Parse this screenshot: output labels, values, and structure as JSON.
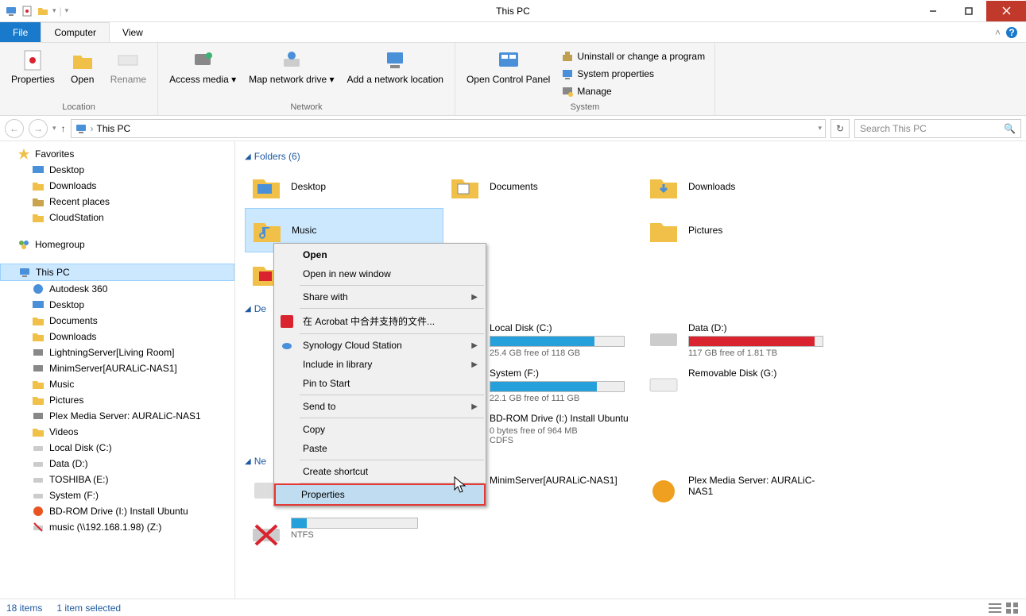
{
  "window": {
    "title": "This PC"
  },
  "tabs": {
    "file": "File",
    "computer": "Computer",
    "view": "View"
  },
  "ribbon": {
    "location": {
      "label": "Location",
      "properties": "Properties",
      "open": "Open",
      "rename": "Rename"
    },
    "network": {
      "label": "Network",
      "access_media": "Access media",
      "map_network": "Map network drive",
      "add_location": "Add a network location"
    },
    "system": {
      "label": "System",
      "open_cp": "Open Control Panel",
      "uninstall": "Uninstall or change a program",
      "sys_props": "System properties",
      "manage": "Manage"
    }
  },
  "breadcrumb": {
    "location": "This PC"
  },
  "search": {
    "placeholder": "Search This PC"
  },
  "sidebar": {
    "favorites": "Favorites",
    "fav_items": [
      "Desktop",
      "Downloads",
      "Recent places",
      "CloudStation"
    ],
    "homegroup": "Homegroup",
    "this_pc": "This PC",
    "pc_items": [
      "Autodesk 360",
      "Desktop",
      "Documents",
      "Downloads",
      "LightningServer[Living Room]",
      "MinimServer[AURALiC-NAS1]",
      "Music",
      "Pictures",
      "Plex Media Server: AURALiC-NAS1",
      "Videos",
      "Local Disk (C:)",
      "Data (D:)",
      "TOSHIBA (E:)",
      "System (F:)",
      "BD-ROM Drive (I:) Install Ubuntu",
      "music (\\\\192.168.1.98) (Z:)"
    ]
  },
  "content": {
    "folders_header": "Folders (6)",
    "devices_header": "De",
    "network_header": "Ne",
    "folders": [
      "Desktop",
      "Documents",
      "Downloads",
      "Music",
      "Pictures",
      "Videos"
    ],
    "drives": [
      {
        "name": "Local Disk (C:)",
        "sub": "25.4 GB free of 118 GB",
        "fill": 78,
        "color": "#26a0da"
      },
      {
        "name": "Data (D:)",
        "sub": "117 GB free of 1.81 TB",
        "fill": 94,
        "color": "#d9232e"
      },
      {
        "name": "System (F:)",
        "sub": "22.1 GB free of 111 GB",
        "fill": 80,
        "color": "#26a0da"
      },
      {
        "name": "Removable Disk (G:)",
        "sub": "",
        "fill": 0,
        "color": ""
      },
      {
        "name": "BD-ROM Drive (I:) Install Ubuntu",
        "sub": "0 bytes free of 964 MB",
        "sub2": "CDFS",
        "fill": 0,
        "color": ""
      }
    ],
    "network_items": [
      "MinimServer[AURALiC-NAS1]",
      "Plex Media Server: AURALiC-NAS1"
    ],
    "ntfs_label": "NTFS"
  },
  "context_menu": {
    "open": "Open",
    "open_new": "Open in new window",
    "share": "Share with",
    "acrobat": "在 Acrobat 中合并支持的文件...",
    "synology": "Synology Cloud Station",
    "include": "Include in library",
    "pin": "Pin to Start",
    "sendto": "Send to",
    "copy": "Copy",
    "paste": "Paste",
    "shortcut": "Create shortcut",
    "properties": "Properties"
  },
  "statusbar": {
    "items": "18 items",
    "selected": "1 item selected"
  }
}
